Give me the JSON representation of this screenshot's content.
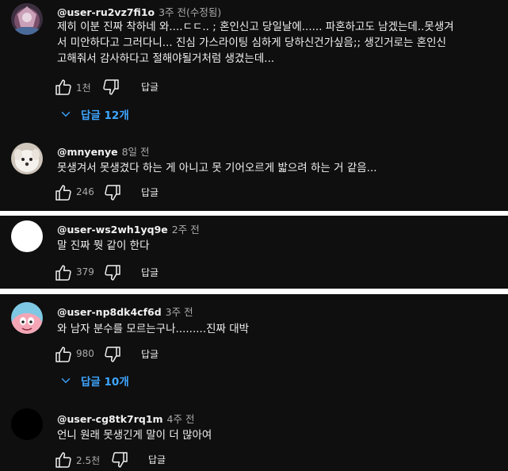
{
  "comments": [
    {
      "author": "@user-ru2vz7fi1o",
      "time": "3주 전(수정됨)",
      "text": "제히 이분 진짜 착하네 와....ㄷㄷ.. ; 혼인신고 당일날에...... 파혼하고도 남겠는데..못생겨\n서 미안하다고 그러다니... 진심 가스라이팅 심하게 당하신건가싶음;; 생긴거로는 혼인신\n고해줘서 감사하다고 절해야될거처럼 생겼는데...",
      "likes": "1천",
      "reply_label": "답글",
      "replies_label": "답글 12개"
    },
    {
      "author": "@mnyenye",
      "time": "8일 전",
      "text": "못생겨서 못생겼다 하는 게 아니고 못 기어오르게 밟으려 하는 거 같음...",
      "likes": "246",
      "reply_label": "답글"
    },
    {
      "author": "@user-ws2wh1yq9e",
      "time": "2주 전",
      "text": "말 진짜 뭣 같이 한다",
      "likes": "379",
      "reply_label": "답글"
    },
    {
      "author": "@user-np8dk4cf6d",
      "time": "3주 전",
      "text": "와 남자 분수를 모르는구나.........진짜 대박",
      "likes": "980",
      "reply_label": "답글",
      "replies_label": "답글 10개"
    },
    {
      "author": "@user-cg8tk7rq1m",
      "time": "4주 전",
      "text": "언니 원래 못생긴게 말이 더 많아여",
      "likes": "2.5천",
      "reply_label": "답글"
    }
  ],
  "icons": {
    "like": "thumbs-up-outline-icon",
    "dislike": "thumbs-down-outline-icon",
    "expand": "chevron-down-icon"
  },
  "colors": {
    "background": "#0f0f0f",
    "text": "#f1f1f1",
    "secondary_text": "#aaaaaa",
    "link": "#3ea6ff",
    "separator": "#ffffff"
  }
}
